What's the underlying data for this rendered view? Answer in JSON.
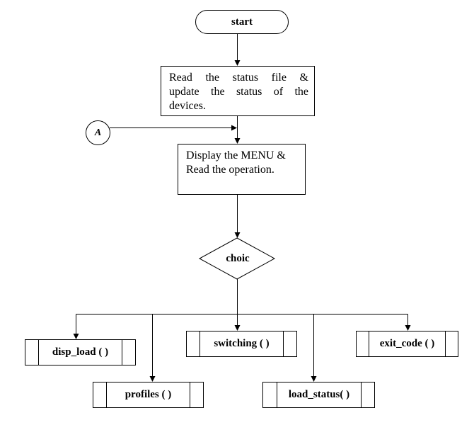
{
  "diagram": {
    "type": "flowchart",
    "nodes": {
      "start": {
        "shape": "terminator",
        "label": "start"
      },
      "read_status": {
        "shape": "process",
        "lines": [
          "Read the status file &",
          "update the status of the",
          "devices."
        ]
      },
      "connector_a": {
        "shape": "connector",
        "label": "A"
      },
      "display_menu": {
        "shape": "process",
        "lines": [
          "Display the MENU &",
          "Read the operation."
        ]
      },
      "choice": {
        "shape": "decision",
        "label": "choic"
      },
      "disp_load": {
        "shape": "predefined-process",
        "label": "disp_load ( )"
      },
      "profiles": {
        "shape": "predefined-process",
        "label": "profiles ( )"
      },
      "switching": {
        "shape": "predefined-process",
        "label": "switching ( )"
      },
      "load_status": {
        "shape": "predefined-process",
        "label": "load_status( )"
      },
      "exit_code": {
        "shape": "predefined-process",
        "label": "exit_code ( )"
      }
    },
    "edges": [
      {
        "from": "start",
        "to": "read_status"
      },
      {
        "from": "read_status",
        "to": "display_menu"
      },
      {
        "from": "connector_a",
        "to": "display_menu"
      },
      {
        "from": "display_menu",
        "to": "choice"
      },
      {
        "from": "choice",
        "to": "disp_load"
      },
      {
        "from": "choice",
        "to": "profiles"
      },
      {
        "from": "choice",
        "to": "switching"
      },
      {
        "from": "choice",
        "to": "load_status"
      },
      {
        "from": "choice",
        "to": "exit_code"
      }
    ]
  }
}
